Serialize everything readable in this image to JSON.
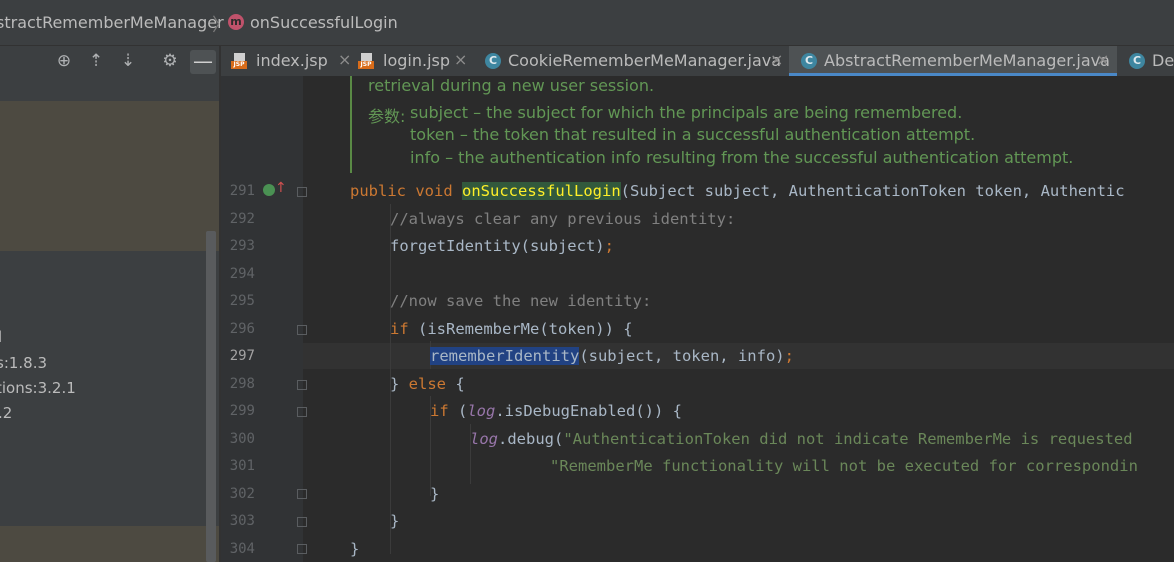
{
  "breadcrumb": {
    "class_name": "stractRememberMeManager",
    "separator": "〉",
    "method_badge": "m",
    "method_name": "onSuccessfulLogin"
  },
  "project_toolbar": {
    "icons": [
      "locate-icon",
      "expand-all-icon",
      "collapse-all-icon",
      "gear-icon",
      "hide-icon"
    ],
    "minus": "—"
  },
  "project_tree": {
    "items": [
      "l",
      "s:1.8.3",
      "tions:3.2.1",
      ".2"
    ]
  },
  "tabs": [
    {
      "label": "index.jsp",
      "icon": "jsp-file-icon",
      "close": "×",
      "active": false
    },
    {
      "label": "login.jsp",
      "icon": "jsp-file-icon",
      "close": "×",
      "active": false
    },
    {
      "label": "CookieRememberMeManager.java",
      "icon": "java-class-icon",
      "close": "×",
      "active": false
    },
    {
      "label": "AbstractRememberMeManager.java",
      "icon": "java-class-icon",
      "close": "×",
      "active": true
    },
    {
      "label": "Dev",
      "icon": "java-class-icon",
      "close": "",
      "active": false
    }
  ],
  "javadoc": {
    "line0": "retrieval during a new user session.",
    "params_label": "参数:",
    "param1": "subject – the subject for which the principals are being remembered.",
    "param2": "token – the token that resulted in a successful authentication attempt.",
    "param3": "info – the authentication info resulting from the successful authentication attempt."
  },
  "code_lines": [
    {
      "num": "291",
      "kw1": "public",
      "kw2": "void",
      "method": "onSuccessfulLogin",
      "rest": "(Subject subject, AuthenticationToken token, Authentic"
    },
    {
      "num": "292",
      "comment": "//always clear any previous identity:"
    },
    {
      "num": "293",
      "call": "forgetIdentity(subject)",
      "semi": ";"
    },
    {
      "num": "294"
    },
    {
      "num": "295",
      "comment": "//now save the new identity:"
    },
    {
      "num": "296",
      "kw": "if",
      "rest": " (isRememberMe(token)) {"
    },
    {
      "num": "297",
      "sel": "rememberIdentity",
      "rest": "(subject, token, info)",
      "semi": ";"
    },
    {
      "num": "298",
      "open": "} ",
      "kw": "else",
      "rest": " {"
    },
    {
      "num": "299",
      "kw": "if",
      "pre": " (",
      "field": "log",
      "rest": ".isDebugEnabled()) {"
    },
    {
      "num": "300",
      "field": "log",
      "rest": ".debug(",
      "str": "\"AuthenticationToken did not indicate RememberMe is requested"
    },
    {
      "num": "301",
      "str": "\"RememberMe functionality will not be executed for correspondin"
    },
    {
      "num": "302",
      "text": "}"
    },
    {
      "num": "303",
      "text": "}"
    },
    {
      "num": "304",
      "text": "}"
    }
  ]
}
